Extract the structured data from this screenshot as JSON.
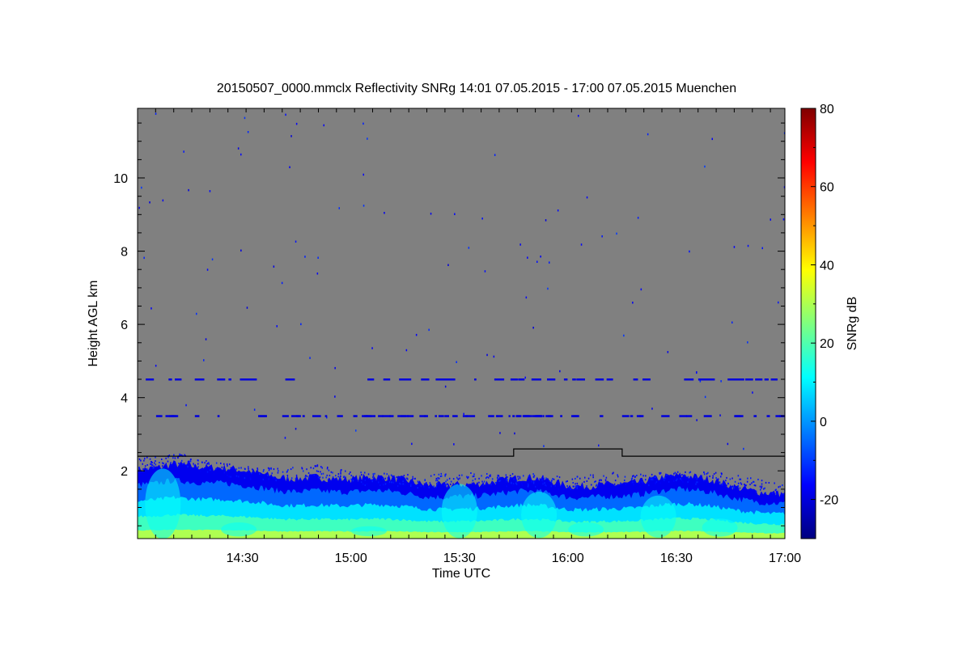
{
  "chart_data": {
    "type": "heatmap",
    "title": "20150507_0000.mmclx Reflectivity SNRg   14:01 07.05.2015 - 17:00 07.05.2015 Muenchen",
    "xlabel": "Time UTC",
    "ylabel": "Height AGL km",
    "colorbar_label": "SNRg dB",
    "x_range_min": [
      841,
      1020
    ],
    "y_range_km": [
      0.15,
      11.9
    ],
    "color_range_db": [
      -30,
      80
    ],
    "x_ticks": [
      {
        "min": 870,
        "label": "14:30"
      },
      {
        "min": 900,
        "label": "15:00"
      },
      {
        "min": 930,
        "label": "15:30"
      },
      {
        "min": 960,
        "label": "16:00"
      },
      {
        "min": 990,
        "label": "16:30"
      },
      {
        "min": 1020,
        "label": "17:00"
      }
    ],
    "y_ticks": [
      {
        "km": 2,
        "label": "2"
      },
      {
        "km": 4,
        "label": "4"
      },
      {
        "km": 6,
        "label": "6"
      },
      {
        "km": 8,
        "label": "8"
      },
      {
        "km": 10,
        "label": "10"
      }
    ],
    "colorbar_ticks": [
      {
        "db": -20,
        "label": "-20"
      },
      {
        "db": 0,
        "label": "0"
      },
      {
        "db": 20,
        "label": "20"
      },
      {
        "db": 40,
        "label": "40"
      },
      {
        "db": 60,
        "label": "60"
      },
      {
        "db": 80,
        "label": "80"
      }
    ],
    "colormap": [
      "#00007f",
      "#0000ff",
      "#007fff",
      "#00ffff",
      "#7fff7f",
      "#ffff00",
      "#ff7f00",
      "#ff0000",
      "#7f0000"
    ],
    "background_color": "#808080",
    "boundary_line": [
      {
        "min": 841,
        "km": 2.4
      },
      {
        "min": 945,
        "km": 2.4
      },
      {
        "min": 945,
        "km": 2.6
      },
      {
        "min": 975,
        "km": 2.6
      },
      {
        "min": 975,
        "km": 2.4
      },
      {
        "min": 1020,
        "km": 2.4
      }
    ],
    "echo_top_km": [
      {
        "min": 841,
        "km": 2.1
      },
      {
        "min": 851,
        "km": 2.3
      },
      {
        "min": 860,
        "km": 2.05
      },
      {
        "min": 870,
        "km": 1.9
      },
      {
        "min": 880,
        "km": 1.85
      },
      {
        "min": 890,
        "km": 1.95
      },
      {
        "min": 900,
        "km": 1.75
      },
      {
        "min": 910,
        "km": 1.7
      },
      {
        "min": 920,
        "km": 1.65
      },
      {
        "min": 930,
        "km": 1.75
      },
      {
        "min": 940,
        "km": 1.7
      },
      {
        "min": 950,
        "km": 1.7
      },
      {
        "min": 960,
        "km": 1.6
      },
      {
        "min": 970,
        "km": 1.75
      },
      {
        "min": 980,
        "km": 1.7
      },
      {
        "min": 990,
        "km": 1.75
      },
      {
        "min": 1000,
        "km": 1.75
      },
      {
        "min": 1010,
        "km": 1.6
      },
      {
        "min": 1020,
        "km": 1.4
      }
    ],
    "echo_layers": [
      {
        "name": "weak",
        "top_fraction": 1.0,
        "db": -18
      },
      {
        "name": "low",
        "top_fraction": 0.78,
        "db": -5
      },
      {
        "name": "mid",
        "top_fraction": 0.55,
        "db": 8
      },
      {
        "name": "strong",
        "top_fraction": 0.32,
        "db": 18
      },
      {
        "name": "near-surface",
        "top_fraction": 0.12,
        "db": 30
      }
    ],
    "scattered_echo_bands_km": [
      4.5,
      3.5
    ],
    "echo_cells": [
      {
        "min": 848,
        "km": 1.9
      },
      {
        "min": 869,
        "km": 0.5
      },
      {
        "min": 905,
        "km": 0.4
      },
      {
        "min": 930,
        "km": 1.5
      },
      {
        "min": 952,
        "km": 1.3
      },
      {
        "min": 965,
        "km": 0.5
      },
      {
        "min": 985,
        "km": 1.2
      },
      {
        "min": 1002,
        "km": 0.6
      }
    ]
  }
}
